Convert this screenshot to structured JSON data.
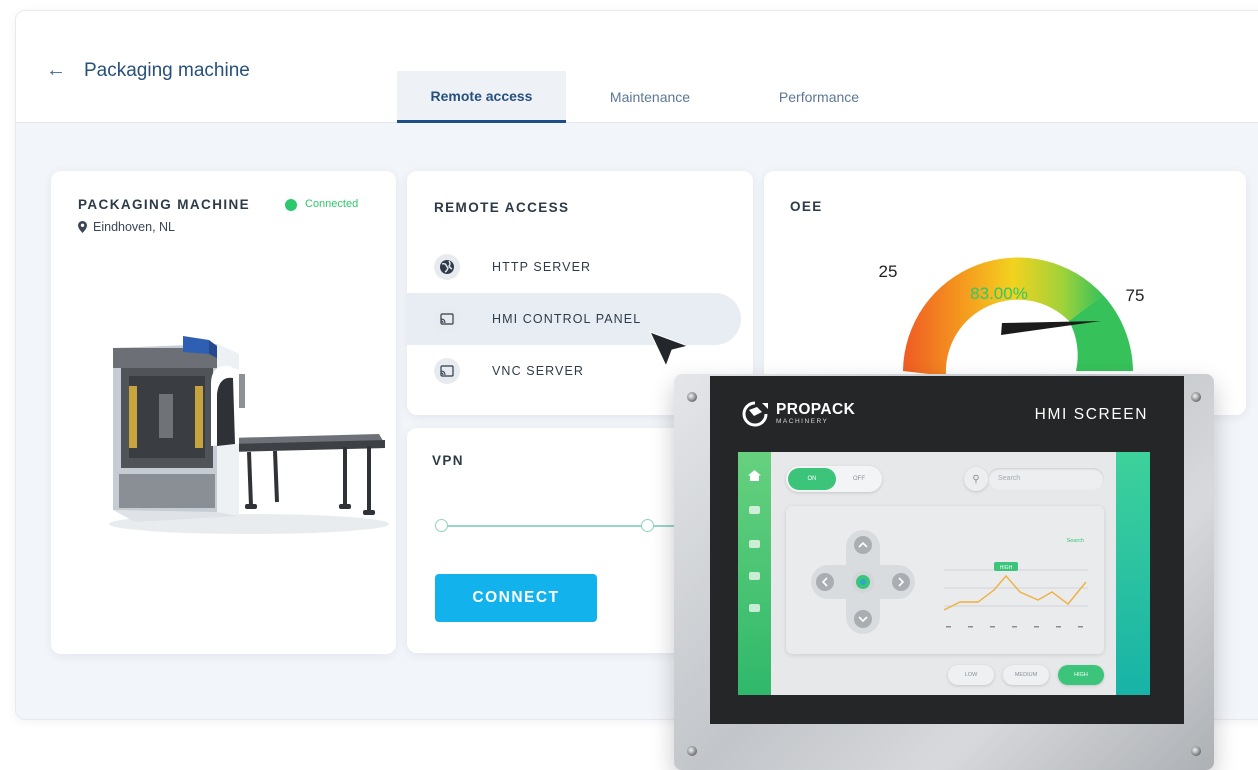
{
  "header": {
    "back_label": "←",
    "title": "Packaging machine",
    "tabs": [
      {
        "label": "Remote access",
        "active": true
      },
      {
        "label": "Maintenance",
        "active": false
      },
      {
        "label": "Performance",
        "active": false
      }
    ]
  },
  "machine": {
    "title": "PACKAGING MACHINE",
    "status": "Connected",
    "status_color": "#2ec86c",
    "location": "Eindhoven, NL",
    "location_icon": "map-pin-icon"
  },
  "remote_access": {
    "title": "REMOTE ACCESS",
    "items": [
      {
        "label": "HTTP SERVER",
        "icon": "globe-icon",
        "selected": false
      },
      {
        "label": "HMI CONTROL PANEL",
        "icon": "cast-icon",
        "selected": true
      },
      {
        "label": "VNC SERVER",
        "icon": "cast-icon",
        "selected": false
      }
    ]
  },
  "vpn": {
    "title": "VPN",
    "connect_label": "CONNECT",
    "accent_color": "#12b2ec"
  },
  "oee": {
    "title": "OEE",
    "value": 83,
    "value_label": "83.00%",
    "scale_labels": [
      "25",
      "75"
    ],
    "value_color": "#2ec86c"
  },
  "hmi": {
    "brand": "PROPACK",
    "brand_sub": "MACHINERY",
    "title": "HMI SCREEN",
    "toggle_on": "ON",
    "toggle_off": "OFF",
    "search_placeholder": "Search",
    "chart_legend": "Search",
    "chart_tag": "HIGH",
    "speeds": [
      "LOW",
      "MEDIUM",
      "HIGH"
    ]
  }
}
